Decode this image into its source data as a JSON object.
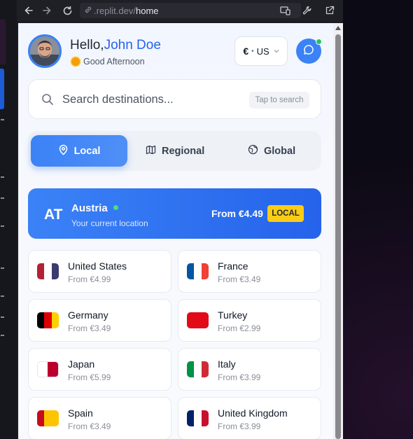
{
  "browser": {
    "url_prefix": ".replit.dev/",
    "url_path": "home",
    "icons": [
      "back-arrow-icon",
      "forward-arrow-icon",
      "reload-icon",
      "site-info-icon",
      "devices-icon",
      "wrench-icon",
      "open-external-icon"
    ]
  },
  "header": {
    "greeting_prefix": "Hello,",
    "user_name": "John Doe",
    "time_greeting": "Good Afternoon",
    "currency_symbol": "€",
    "currency_separator": "•",
    "region_code": "US",
    "chat_status_color": "#22c55e"
  },
  "search": {
    "placeholder": "Search destinations...",
    "hint": "Tap to search"
  },
  "tabs": [
    {
      "label": "Local",
      "icon": "map-pin-icon",
      "active": true
    },
    {
      "label": "Regional",
      "icon": "map-icon",
      "active": false
    },
    {
      "label": "Global",
      "icon": "globe-icon",
      "active": false
    }
  ],
  "current_location": {
    "code": "AT",
    "country": "Austria",
    "subtitle": "Your current location",
    "price": "From €4.49",
    "badge": "LOCAL"
  },
  "countries": [
    {
      "name": "United States",
      "price": "From €4.99",
      "flag": [
        "#b22234",
        "#ffffff",
        "#3c3b6e"
      ]
    },
    {
      "name": "France",
      "price": "From €3.49",
      "flag": [
        "#0055a4",
        "#ffffff",
        "#ef4135"
      ]
    },
    {
      "name": "Germany",
      "price": "From €3.49",
      "flag": [
        "#000000",
        "#dd0000",
        "#ffce00"
      ]
    },
    {
      "name": "Turkey",
      "price": "From €2.99",
      "flag": [
        "#e30a17",
        "#e30a17",
        "#e30a17"
      ]
    },
    {
      "name": "Japan",
      "price": "From €5.99",
      "flag": [
        "#ffffff",
        "#ffffff",
        "#bc002d"
      ]
    },
    {
      "name": "Italy",
      "price": "From €3.99",
      "flag": [
        "#009246",
        "#ffffff",
        "#ce2b37"
      ]
    },
    {
      "name": "Spain",
      "price": "From €3.49",
      "flag": [
        "#c60b1e",
        "#ffc400",
        "#ffc400"
      ]
    },
    {
      "name": "United Kingdom",
      "price": "From €3.99",
      "flag": [
        "#012169",
        "#ffffff",
        "#c8102e"
      ]
    }
  ],
  "colors": {
    "accent": "#3b82f6",
    "badge": "#facc15",
    "live_dot": "#4ade80"
  }
}
